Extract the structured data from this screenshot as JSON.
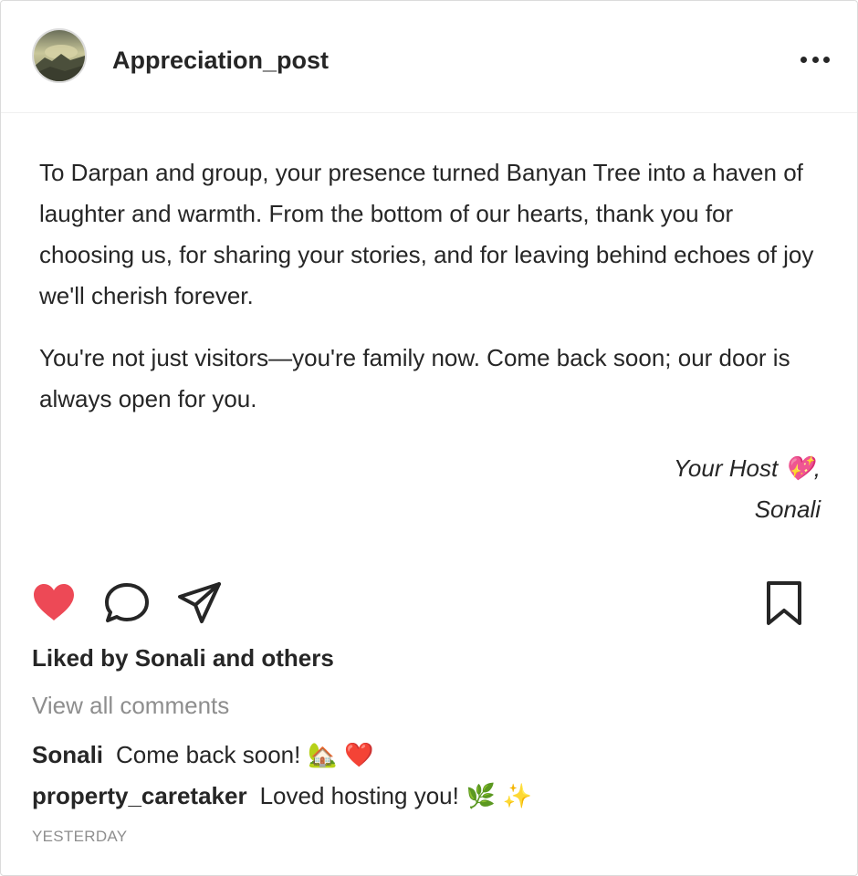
{
  "post": {
    "username": "Appreciation_post",
    "more_label": "More options",
    "caption_paragraphs": [
      "To Darpan and group, your presence turned Banyan Tree into a haven of laughter and warmth. From the bottom of our hearts, thank you for choosing us, for sharing your stories, and for leaving behind echoes of joy we'll cherish forever.",
      "You're not just visitors—you're family now. Come back soon; our door is always open for you."
    ],
    "signoff_line1": "Your Host 💖,",
    "signoff_line2": "Sonali"
  },
  "actions": {
    "like_icon": "heart-icon",
    "comment_icon": "comment-bubble-icon",
    "share_icon": "paper-plane-icon",
    "save_icon": "bookmark-icon",
    "like_color": "#ed4956"
  },
  "likes_text": "Liked by Sonali and others",
  "view_comments_text": "View all comments",
  "comments": [
    {
      "author": "Sonali",
      "text": "Come back soon!",
      "emoji": "🏡 ❤️"
    },
    {
      "author": "property_caretaker",
      "text": "Loved hosting you!",
      "emoji": "🌿 ✨"
    }
  ],
  "timestamp": "YESTERDAY"
}
